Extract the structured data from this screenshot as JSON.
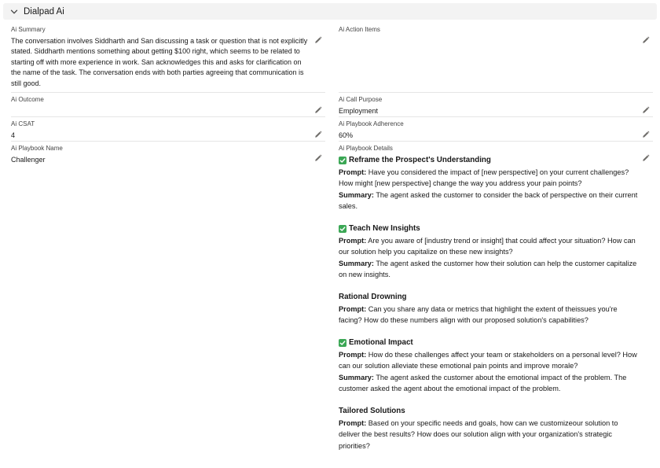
{
  "section": {
    "title": "Dialpad Ai"
  },
  "fields": {
    "summary": {
      "label": "Ai Summary",
      "value": "The conversation involves Siddharth and San discussing a task or question that is not explicitly stated. Siddharth mentions something about getting $100 right, which seems to be related to starting off with more experience in work. San acknowledges this and asks for clarification on the name of the task. The conversation ends with both parties agreeing that communication is still good."
    },
    "action_items": {
      "label": "Ai Action Items",
      "value": ""
    },
    "outcome": {
      "label": "Ai Outcome",
      "value": ""
    },
    "call_purpose": {
      "label": "Ai Call Purpose",
      "value": "Employment"
    },
    "csat": {
      "label": "Ai CSAT",
      "value": "4"
    },
    "adherence": {
      "label": "Ai Playbook Adherence",
      "value": "60%"
    },
    "playbook_name": {
      "label": "Ai Playbook Name",
      "value": "Challenger"
    },
    "playbook_details": {
      "label": "Ai Playbook Details"
    }
  },
  "playbook": {
    "prompt_label": "Prompt:",
    "summary_label": "Summary:",
    "items": [
      {
        "title": "Reframe the Prospect's Understanding",
        "checked": true,
        "prompt": " Have you considered the impact of [new perspective] on your current challenges? How might [new perspective] change the way you address your pain points?",
        "summary": " The agent asked the customer to consider the back of perspective on their current sales."
      },
      {
        "title": "Teach New Insights",
        "checked": true,
        "prompt": " Are you aware of [industry trend or insight] that could affect your situation? How can our solution help you capitalize on these new insights?",
        "summary": " The agent asked the customer how their solution can help the customer capitalize on new insights."
      },
      {
        "title": "Rational Drowning",
        "checked": false,
        "prompt": " Can you share any data or metrics that highlight the extent of theissues you're facing? How do these numbers align with our proposed solution's capabilities?"
      },
      {
        "title": "Emotional Impact",
        "checked": true,
        "prompt": " How do these challenges affect your team or stakeholders on a personal level? How can our solution alleviate these emotional pain points and improve morale?",
        "summary": " The agent asked the customer about the emotional impact of the problem. The customer asked the agent about the emotional impact of the problem."
      },
      {
        "title": "Tailored Solutions",
        "checked": false,
        "prompt": " Based on your specific needs and goals, how can we customizeour solution to deliver the best results? How does our solution align with your organization's strategic priorities?"
      }
    ]
  },
  "colors": {
    "check": "#3ba755",
    "header_bg": "#f3f3f3",
    "rule": "#e5e5e5"
  },
  "icons": {
    "collapse": "chevron-down-icon",
    "edit": "pencil-icon",
    "check": "check-icon"
  }
}
